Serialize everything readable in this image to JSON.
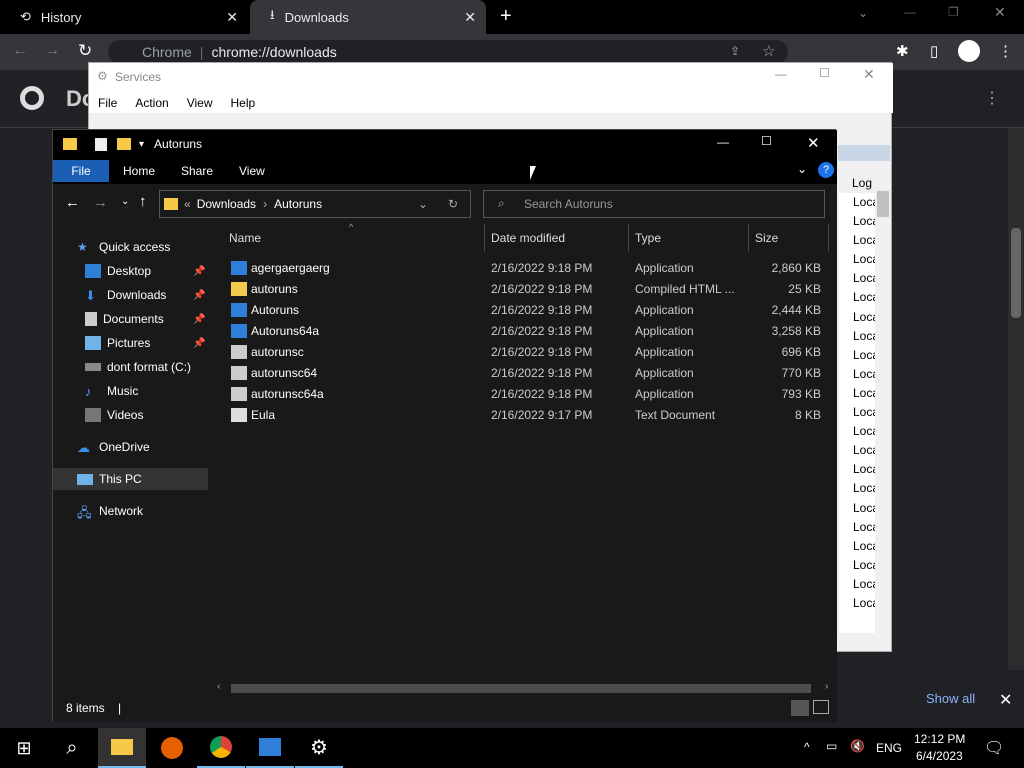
{
  "chrome": {
    "tabs": [
      {
        "label": "History"
      },
      {
        "label": "Downloads"
      }
    ],
    "address_prefix": "Chrome",
    "address_url": "chrome://downloads",
    "header_title": "Do",
    "show_all": "Show all"
  },
  "services": {
    "title": "Services",
    "menu": [
      "File",
      "Action",
      "View",
      "Help"
    ],
    "list_header": "Log",
    "list_items": [
      "Loca",
      "Loca",
      "Loca",
      "Loca",
      "Loca",
      "Loca",
      "Loca",
      "Loca",
      "Loca",
      "Loca",
      "Loca",
      "Loca",
      "Loca",
      "Loca",
      "Loca",
      "Loca",
      "Loca",
      "Loca",
      "Loca",
      "Loca",
      "Loca",
      "Loca"
    ]
  },
  "explorer": {
    "title": "Autoruns",
    "ribbon": {
      "file": "File",
      "home": "Home",
      "share": "Share",
      "view": "View"
    },
    "breadcrumb": [
      "Downloads",
      "Autoruns"
    ],
    "search_placeholder": "Search Autoruns",
    "nav": {
      "quick_access": "Quick access",
      "desktop": "Desktop",
      "downloads": "Downloads",
      "documents": "Documents",
      "pictures": "Pictures",
      "drive": "dont  format (C:)",
      "music": "Music",
      "videos": "Videos",
      "onedrive": "OneDrive",
      "this_pc": "This PC",
      "network": "Network"
    },
    "columns": {
      "name": "Name",
      "date": "Date modified",
      "type": "Type",
      "size": "Size"
    },
    "files": [
      {
        "name": "agergaergaerg",
        "date": "2/16/2022 9:18 PM",
        "type": "Application",
        "size": "2,860 KB"
      },
      {
        "name": "autoruns",
        "date": "2/16/2022 9:18 PM",
        "type": "Compiled HTML ...",
        "size": "25 KB"
      },
      {
        "name": "Autoruns",
        "date": "2/16/2022 9:18 PM",
        "type": "Application",
        "size": "2,444 KB"
      },
      {
        "name": "Autoruns64a",
        "date": "2/16/2022 9:18 PM",
        "type": "Application",
        "size": "3,258 KB"
      },
      {
        "name": "autorunsc",
        "date": "2/16/2022 9:18 PM",
        "type": "Application",
        "size": "696 KB"
      },
      {
        "name": "autorunsc64",
        "date": "2/16/2022 9:18 PM",
        "type": "Application",
        "size": "770 KB"
      },
      {
        "name": "autorunsc64a",
        "date": "2/16/2022 9:18 PM",
        "type": "Application",
        "size": "793 KB"
      },
      {
        "name": "Eula",
        "date": "2/16/2022 9:17 PM",
        "type": "Text Document",
        "size": "8 KB"
      }
    ],
    "status": "8 items"
  },
  "taskbar": {
    "lang": "ENG",
    "time": "12:12 PM",
    "date": "6/4/2023"
  }
}
